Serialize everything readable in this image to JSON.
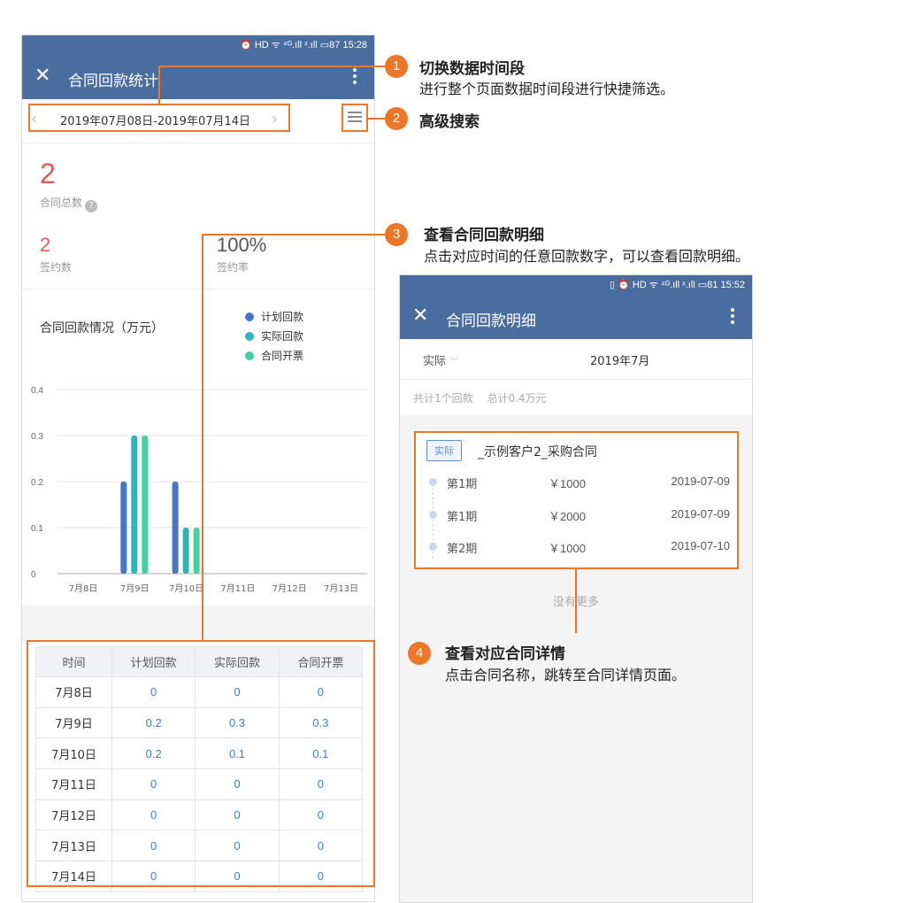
{
  "phone1": {
    "status": "⏰ HD ᯤ ⁴ᴳ.ıll ˣ.ıll ▭87 15:28",
    "title": "合同回款统计",
    "prev": "‹",
    "next": "›",
    "date_range": "2019年07月08日-2019年07月14日",
    "kpi_total": "2",
    "kpi_total_label": "合同总数",
    "help": "?",
    "kpi_signed": "2",
    "kpi_signed_label": "签约数",
    "kpi_rate": "100%",
    "kpi_rate_label": "签约率",
    "chart_title": "合同回款情况（万元）",
    "table": {
      "headers": [
        "时间",
        "计划回款",
        "实际回款",
        "合同开票"
      ],
      "rows": [
        [
          "7月8日",
          "0",
          "0",
          "0"
        ],
        [
          "7月9日",
          "0.2",
          "0.3",
          "0.3"
        ],
        [
          "7月10日",
          "0.2",
          "0.1",
          "0.1"
        ],
        [
          "7月11日",
          "0",
          "0",
          "0"
        ],
        [
          "7月12日",
          "0",
          "0",
          "0"
        ],
        [
          "7月13日",
          "0",
          "0",
          "0"
        ],
        [
          "7月14日",
          "0",
          "0",
          "0"
        ]
      ]
    }
  },
  "chart_data": {
    "type": "bar",
    "categories": [
      "7月8日",
      "7月9日",
      "7月10日",
      "7月11日",
      "7月12日",
      "7月13日"
    ],
    "series": [
      {
        "name": "计划回款",
        "values": [
          0,
          0.2,
          0.2,
          0,
          0,
          0
        ],
        "color": "#4a74c9"
      },
      {
        "name": "实际回款",
        "values": [
          0,
          0.3,
          0.1,
          0,
          0,
          0
        ],
        "color": "#2eb5b7"
      },
      {
        "name": "合同开票",
        "values": [
          0,
          0.3,
          0.1,
          0,
          0,
          0
        ],
        "color": "#43d1a0"
      }
    ],
    "yticks": [
      "0",
      "0.1",
      "0.2",
      "0.3",
      "0.4"
    ],
    "ylim": [
      0,
      0.4
    ],
    "grid": true,
    "legend": "top-right"
  },
  "phone2": {
    "status": "▯ ⏰ HD ᯤ ⁴ᴳ.ıll ˣ.ıll ▭81 15:52",
    "title": "合同回款明细",
    "type_filter": "实际",
    "month": "2019年7月",
    "summary_count": "共计1个回款",
    "summary_total": "总计0.4万元",
    "badge": "实际",
    "contract_name": "_示例客户2_采购合同",
    "installments": [
      {
        "period": "第1期",
        "amount": "￥1000",
        "date": "2019-07-09"
      },
      {
        "period": "第1期",
        "amount": "￥2000",
        "date": "2019-07-09"
      },
      {
        "period": "第2期",
        "amount": "￥1000",
        "date": "2019-07-10"
      }
    ],
    "no_more": "没有更多"
  },
  "annotations": [
    {
      "num": "1",
      "title": "切换数据时间段",
      "desc": "进行整个页面数据时间段进行快捷筛选。"
    },
    {
      "num": "2",
      "title": "高级搜索",
      "desc": ""
    },
    {
      "num": "3",
      "title": "查看合同回款明细",
      "desc": "点击对应时间的任意回款数字，可以查看回款明细。"
    },
    {
      "num": "4",
      "title": "查看对应合同详情",
      "desc": "点击合同名称，跳转至合同详情页面。"
    }
  ],
  "colors": {
    "brand_bar": "#4a6d9f",
    "annotation": "#ee7627",
    "accent_red": "#e8575c",
    "link_blue": "#3d7fc4"
  }
}
